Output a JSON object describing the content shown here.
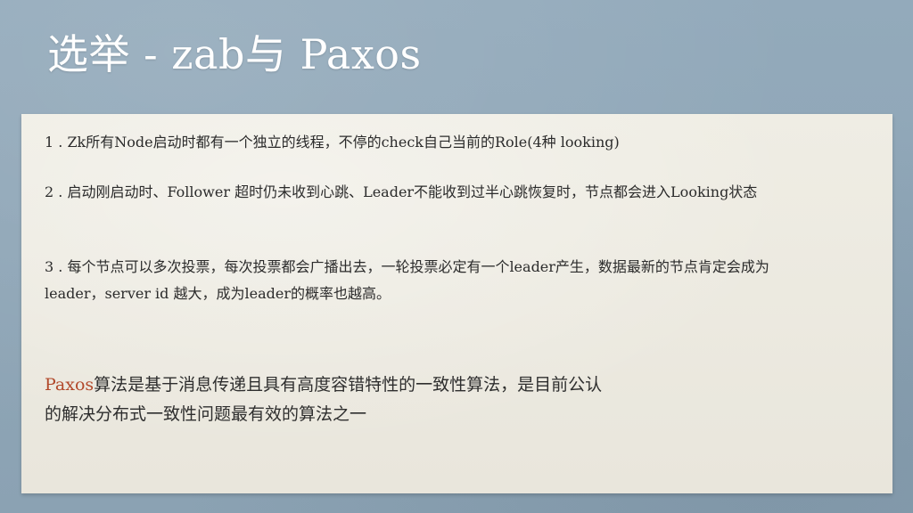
{
  "slide": {
    "title": "选举 - zab与 Paxos"
  },
  "content": {
    "points": [
      "1 . Zk所有Node启动时都有一个独立的线程，不停的check自己当前的Role(4种 looking)",
      "2 . 启动刚启动时、Follower 超时仍未收到心跳、Leader不能收到过半心跳恢复时，节点都会进入Looking状态",
      "3 . 每个节点可以多次投票，每次投票都会广播出去，一轮投票必定有一个leader产生，数据最新的节点肯定会成为leader，server id 越大，成为leader的概率也越高。"
    ],
    "paxos_note": {
      "term": "Paxos",
      "text": "算法是基于消息传递且具有高度容错特性的一致性算法，是目前公认的解决分布式一致性问题最有效的算法之一"
    }
  },
  "colors": {
    "background": "#8fa6b6",
    "panel": "#eeece3",
    "title": "#ffffff",
    "body_text": "#2b2b2b",
    "accent": "#b2492b"
  }
}
